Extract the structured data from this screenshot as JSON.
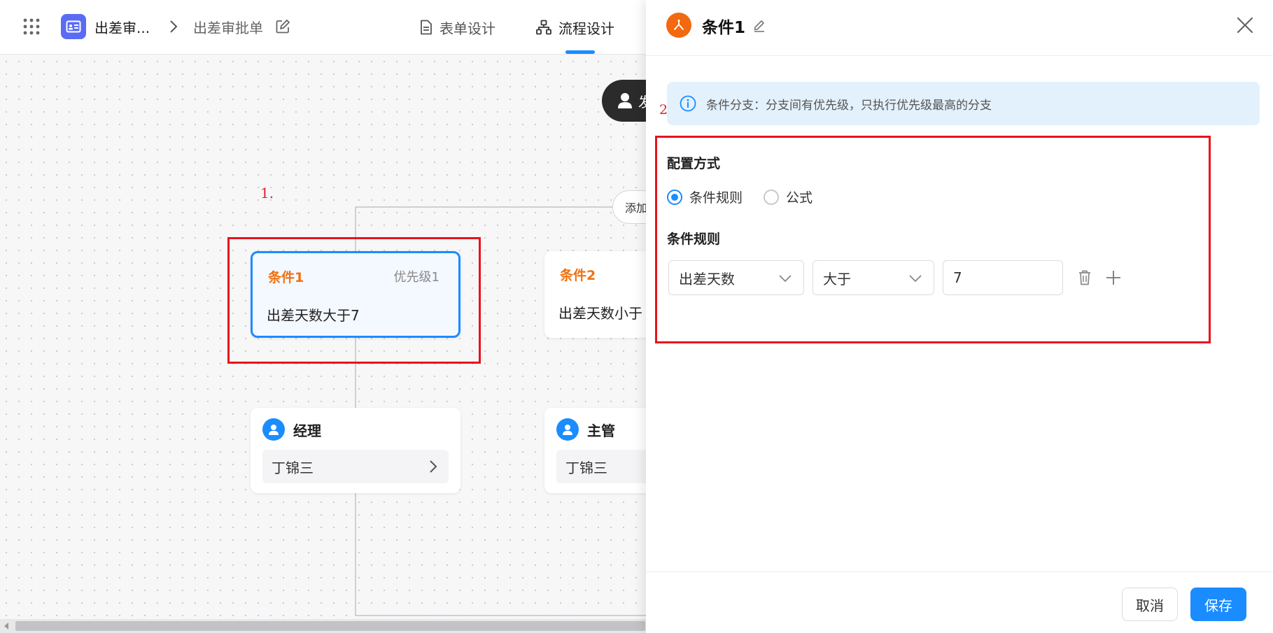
{
  "header": {
    "app_name": "出差审...",
    "breadcrumb_current": "出差审批单",
    "tabs": [
      {
        "label": "表单设计",
        "icon": "document-icon",
        "active": false
      },
      {
        "label": "流程设计",
        "icon": "flow-icon",
        "active": true
      }
    ],
    "accent": "#1a8cff"
  },
  "canvas": {
    "start_node_label": "发",
    "add_condition_label": "添加",
    "annotation_1": "1.",
    "conditions": [
      {
        "title": "条件1",
        "priority": "优先级1",
        "rule": "出差天数大于7",
        "selected": true
      },
      {
        "title": "条件2",
        "rule": "出差天数小于"
      }
    ],
    "approvers": [
      {
        "role": "经理",
        "person": "丁锦三"
      },
      {
        "role": "主管",
        "person": "丁锦三"
      }
    ]
  },
  "drawer": {
    "title": "条件1",
    "annotation_2": "2.",
    "info_text": "条件分支：分支间有优先级，只执行优先级最高的分支",
    "config_mode_label": "配置方式",
    "config_options": [
      {
        "label": "条件规则",
        "selected": true
      },
      {
        "label": "公式",
        "selected": false
      }
    ],
    "rule_section_label": "条件规则",
    "rule": {
      "field": "出差天数",
      "operator": "大于",
      "value": "7"
    },
    "buttons": {
      "cancel": "取消",
      "save": "保存"
    },
    "highlight_color": "#e8121c"
  }
}
